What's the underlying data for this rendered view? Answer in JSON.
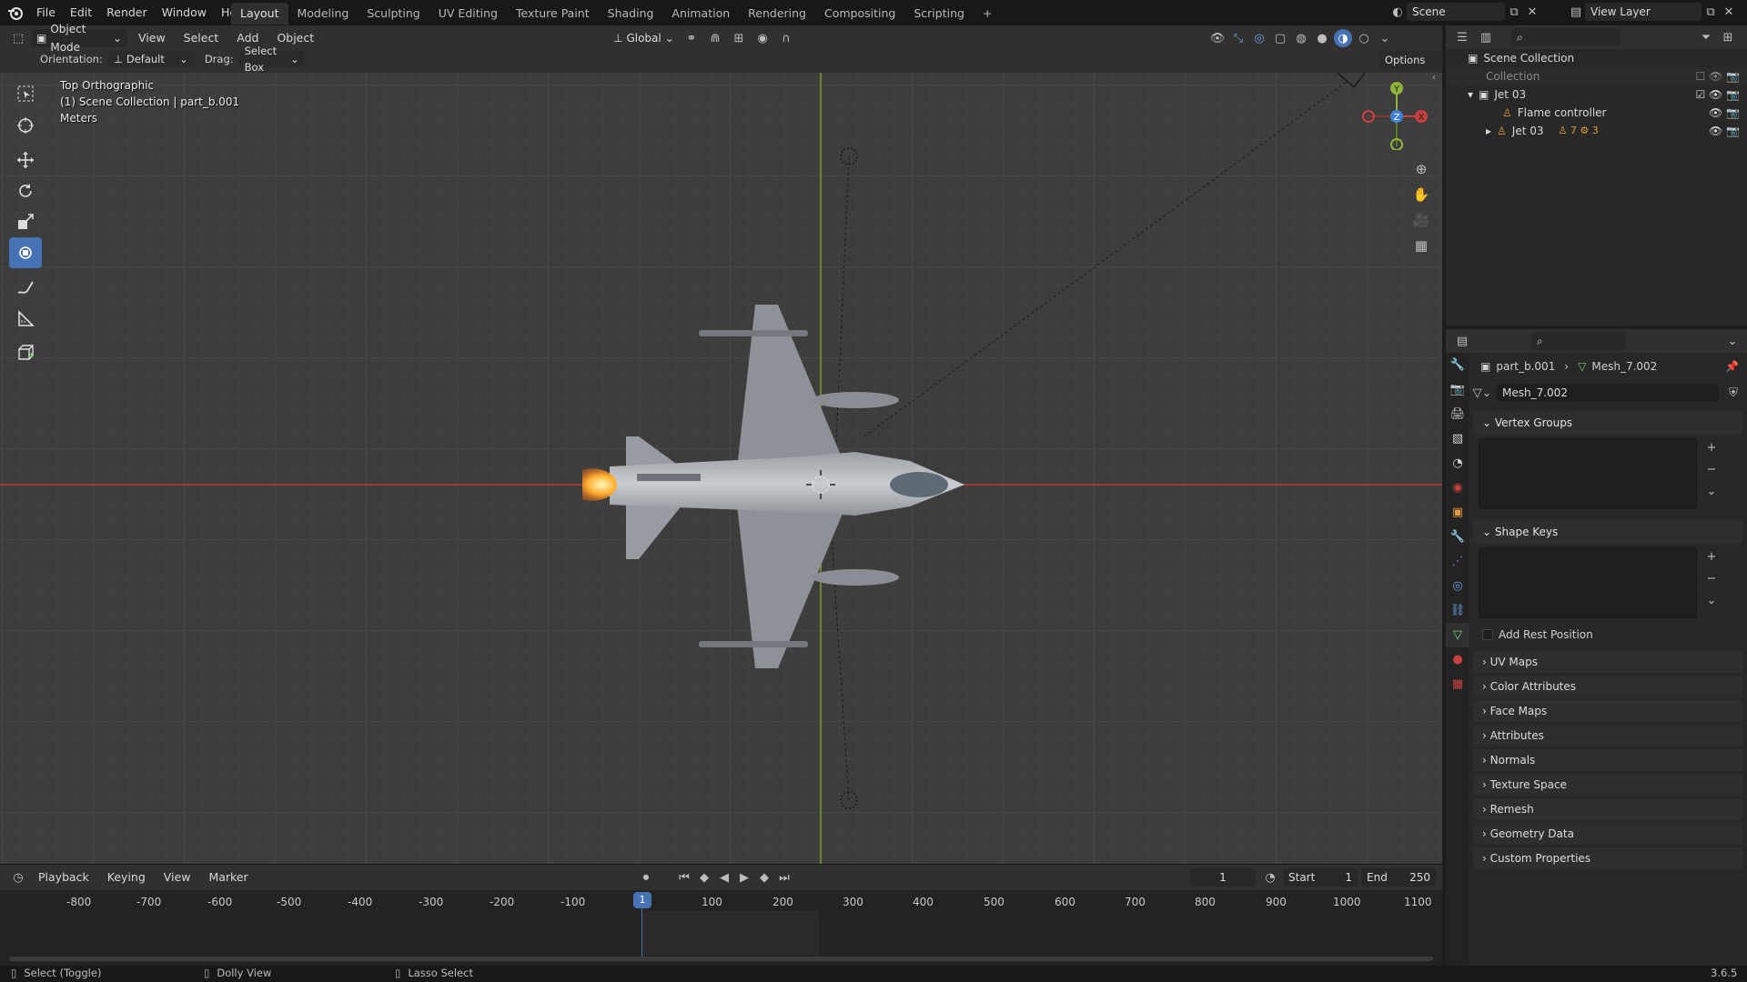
{
  "menubar": {
    "items": [
      "File",
      "Edit",
      "Render",
      "Window",
      "Help"
    ],
    "workspaces": [
      "Layout",
      "Modeling",
      "Sculpting",
      "UV Editing",
      "Texture Paint",
      "Shading",
      "Animation",
      "Rendering",
      "Compositing",
      "Scripting"
    ],
    "active_workspace": "Layout",
    "add_tab": "+",
    "scene": "Scene",
    "view_layer": "View Layer"
  },
  "viewport_header": {
    "mode": "Object Mode",
    "menus": [
      "View",
      "Select",
      "Add",
      "Object"
    ],
    "transform_orientation": "Global",
    "orientation_label": "Orientation:",
    "orientation_value": "Default",
    "drag_label": "Drag:",
    "drag_value": "Select Box",
    "options": "Options"
  },
  "viewport": {
    "view_name": "Top Orthographic",
    "collection_line": "(1) Scene Collection | part_b.001",
    "units": "Meters",
    "gizmo": {
      "y": "Y",
      "z": "Z",
      "x": "X"
    }
  },
  "outliner": {
    "rows": [
      {
        "label": "Scene Collection",
        "indent": 0
      },
      {
        "label": "Collection",
        "indent": 1
      },
      {
        "label": "Jet 03",
        "indent": 1
      },
      {
        "label": "Flame controller",
        "indent": 2
      },
      {
        "label": "Jet 03",
        "indent": 2
      }
    ],
    "jet_badges": [
      "7",
      "3"
    ]
  },
  "properties": {
    "breadcrumb_object": "part_b.001",
    "breadcrumb_mesh": "Mesh_7.002",
    "datablock": "Mesh_7.002",
    "vertex_groups": "Vertex Groups",
    "shape_keys": "Shape Keys",
    "add_rest_position": "Add Rest Position",
    "collapsed_panels": [
      "UV Maps",
      "Color Attributes",
      "Face Maps",
      "Attributes",
      "Normals",
      "Texture Space",
      "Remesh",
      "Geometry Data",
      "Custom Properties"
    ]
  },
  "timeline": {
    "menus": [
      "Playback",
      "Keying",
      "View",
      "Marker"
    ],
    "current_frame": "1",
    "start_label": "Start",
    "start": "1",
    "end_label": "End",
    "end": "250",
    "ticks": [
      "-800",
      "-700",
      "-600",
      "-500",
      "-400",
      "-300",
      "-200",
      "-100",
      "1",
      "100",
      "200",
      "300",
      "400",
      "500",
      "600",
      "700",
      "800",
      "900",
      "1000",
      "1100"
    ]
  },
  "statusbar": {
    "left": "Select (Toggle)",
    "middle": "Dolly View",
    "right": "Lasso Select",
    "version": "3.6.5"
  },
  "colors": {
    "accent": "#4772b3",
    "x_axis": "#c94040",
    "y_axis": "#7ea33a",
    "z_axis": "#3f7fd6"
  }
}
